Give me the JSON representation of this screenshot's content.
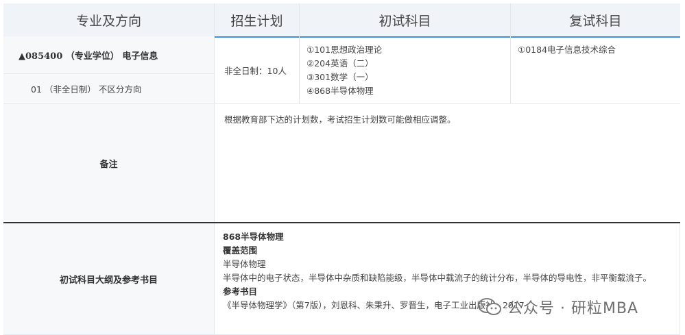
{
  "header": {
    "col1": "专业及方向",
    "col2": "招生计划",
    "col3": "初试科目",
    "col4": "复试科目"
  },
  "program": {
    "code_line": "▲085400 （专业学位） 电子信息",
    "direction": "01 （非全日制） 不区分方向",
    "plan": "非全日制：10人",
    "exam_subjects": [
      "①101思想政治理论",
      "②204英语（二）",
      "③301数学（一）",
      "④868半导体物理"
    ],
    "retest_subjects": [
      "①0184电子信息技术综合"
    ]
  },
  "remarks": {
    "label": "备注",
    "text": "根据教育部下达的计划数，考试招生计划数可能做相应调整。"
  },
  "outline": {
    "label": "初试科目大纲及参考书目",
    "subject": "868半导体物理",
    "scope_title": "覆盖范围",
    "scope_subject": "半导体物理",
    "scope_text": "半导体中的电子状态，半导体中杂质和缺陷能级，半导体中载流子的统计分布，半导体的导电性，非平衡载流子。",
    "ref_title": "参考书目",
    "ref_text": "《半导体物理学》（第7版），刘恩科、朱秉升、罗晋生，电子工业出版社，2017"
  },
  "watermark": {
    "text": "公众号 · 研粒MBA",
    "icon": "wechat-icon"
  }
}
